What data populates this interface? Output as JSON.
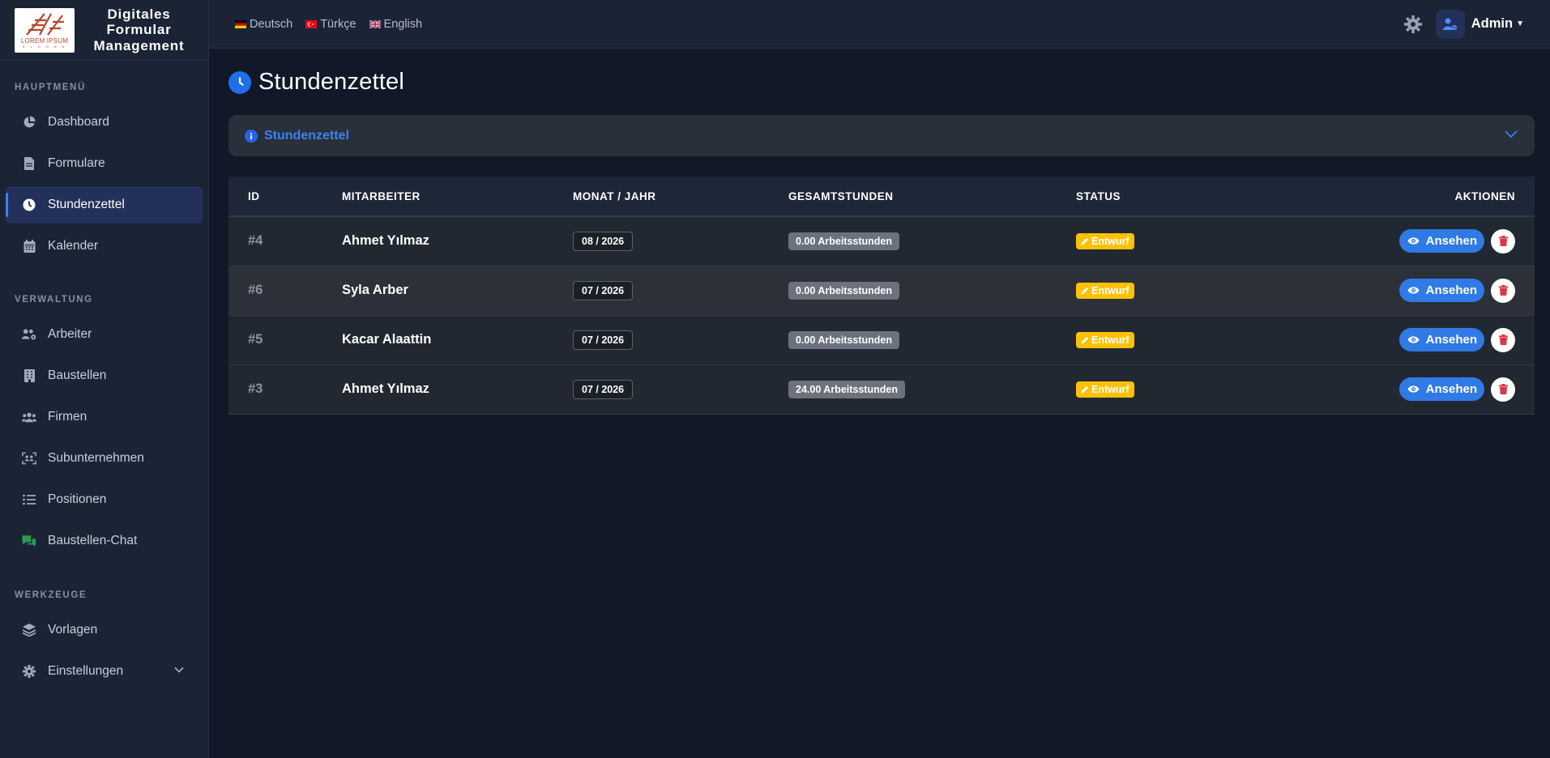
{
  "brand": {
    "title_line1": "Digitales",
    "title_line2": "Formular",
    "title_line3": "Management",
    "logo_text": "LOREM IPSUM",
    "logo_sub": "S L O G A N"
  },
  "sidebar": {
    "sections": [
      {
        "label": "HAUPTMENÜ"
      },
      {
        "label": "VERWALTUNG"
      },
      {
        "label": "WERKZEUGE"
      }
    ],
    "items": [
      {
        "label": "Dashboard",
        "icon": "chart-pie-icon"
      },
      {
        "label": "Formulare",
        "icon": "file-icon"
      },
      {
        "label": "Stundenzettel",
        "icon": "clock-icon",
        "active": true
      },
      {
        "label": "Kalender",
        "icon": "calendar-icon"
      },
      {
        "label": "Arbeiter",
        "icon": "users-gear-icon"
      },
      {
        "label": "Baustellen",
        "icon": "building-icon"
      },
      {
        "label": "Firmen",
        "icon": "people-group-icon"
      },
      {
        "label": "Subunternehmen",
        "icon": "people-frame-icon"
      },
      {
        "label": "Positionen",
        "icon": "list-icon"
      },
      {
        "label": "Baustellen-Chat",
        "icon": "comments-icon"
      },
      {
        "label": "Vorlagen",
        "icon": "layers-icon"
      },
      {
        "label": "Einstellungen",
        "icon": "gear-icon"
      }
    ]
  },
  "topbar": {
    "languages": [
      {
        "label": "Deutsch",
        "flag": "de-flag-icon"
      },
      {
        "label": "Türkçe",
        "flag": "tr-flag-icon"
      },
      {
        "label": "English",
        "flag": "gb-flag-icon"
      }
    ],
    "user": "Admin"
  },
  "page": {
    "title": "Stundenzettel",
    "accordion_label": "Stundenzettel"
  },
  "table": {
    "headers": [
      "ID",
      "MITARBEITER",
      "MONAT / JAHR",
      "GESAMTSTUNDEN",
      "STATUS",
      "AKTIONEN"
    ],
    "rows": [
      {
        "id": "#4",
        "name": "Ahmet Yılmaz",
        "month": "08 / 2026",
        "hours": "0.00 Arbeitsstunden",
        "status": "Entwurf",
        "action": "Ansehen"
      },
      {
        "id": "#6",
        "name": "Syla Arber",
        "month": "07 / 2026",
        "hours": "0.00 Arbeitsstunden",
        "status": "Entwurf",
        "action": "Ansehen"
      },
      {
        "id": "#5",
        "name": "Kacar Alaattin",
        "month": "07 / 2026",
        "hours": "0.00 Arbeitsstunden",
        "status": "Entwurf",
        "action": "Ansehen"
      },
      {
        "id": "#3",
        "name": "Ahmet Yılmaz",
        "month": "07 / 2026",
        "hours": "24.00 Arbeitsstunden",
        "status": "Entwurf",
        "action": "Ansehen"
      }
    ]
  },
  "colors": {
    "accent": "#3b82f6",
    "status_draft": "#ffc107",
    "danger": "#dc3545",
    "sidebar_bg": "#1b2435",
    "main_bg": "#111828"
  }
}
